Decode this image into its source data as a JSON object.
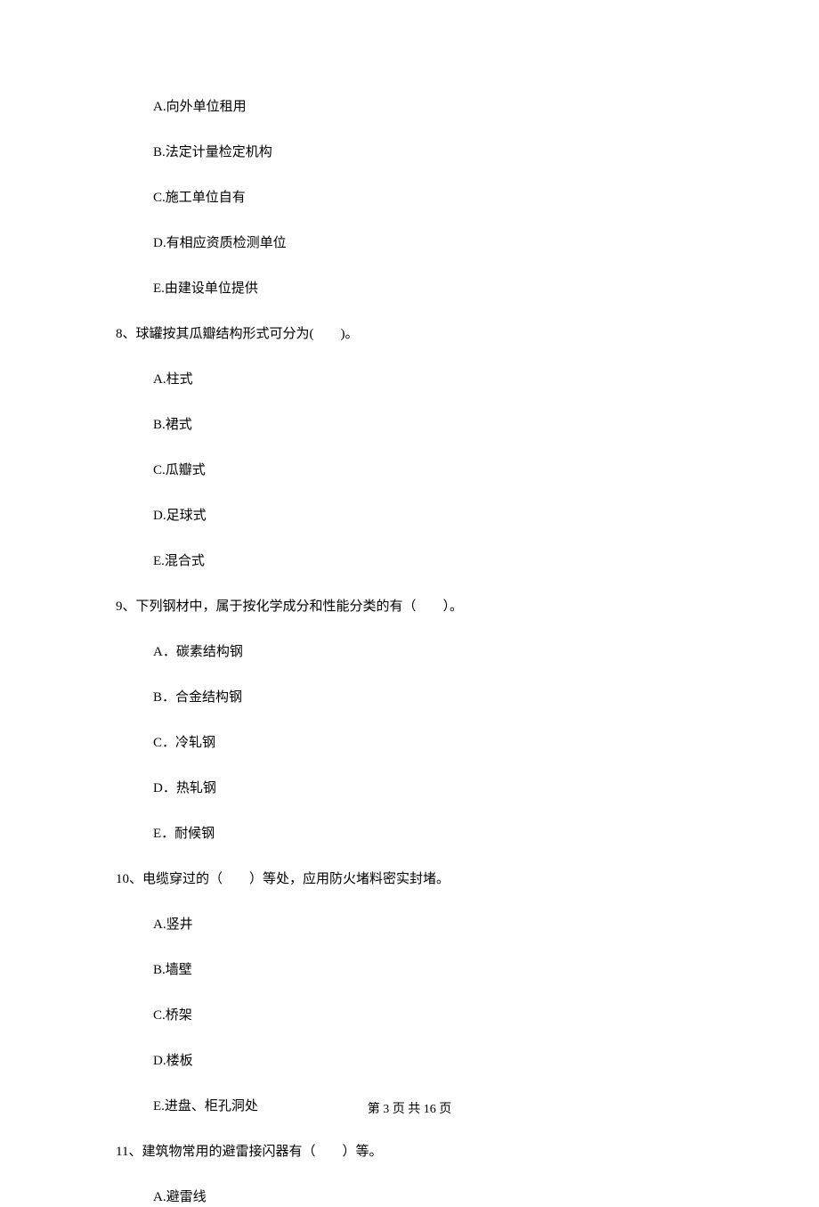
{
  "q7_options": {
    "a": "A.向外单位租用",
    "b": "B.法定计量检定机构",
    "c": "C.施工单位自有",
    "d": "D.有相应资质检测单位",
    "e": "E.由建设单位提供"
  },
  "q8": {
    "stem": "8、球罐按其瓜瓣结构形式可分为(　　)。",
    "a": "A.柱式",
    "b": "B.裙式",
    "c": "C.瓜瓣式",
    "d": "D.足球式",
    "e": "E.混合式"
  },
  "q9": {
    "stem": "9、下列钢材中，属于按化学成分和性能分类的有（　　）。",
    "a": "A．碳素结构钢",
    "b": "B．合金结构钢",
    "c": "C．冷轧钢",
    "d": "D．热轧钢",
    "e": "E．耐候钢"
  },
  "q10": {
    "stem": "10、电缆穿过的（　　）等处，应用防火堵料密实封堵。",
    "a": "A.竖井",
    "b": "B.墙壁",
    "c": "C.桥架",
    "d": "D.楼板",
    "e": "E.进盘、柜孔洞处"
  },
  "q11": {
    "stem": "11、建筑物常用的避雷接闪器有（　　）等。",
    "a": "A.避雷线"
  },
  "footer": "第 3 页 共 16 页"
}
